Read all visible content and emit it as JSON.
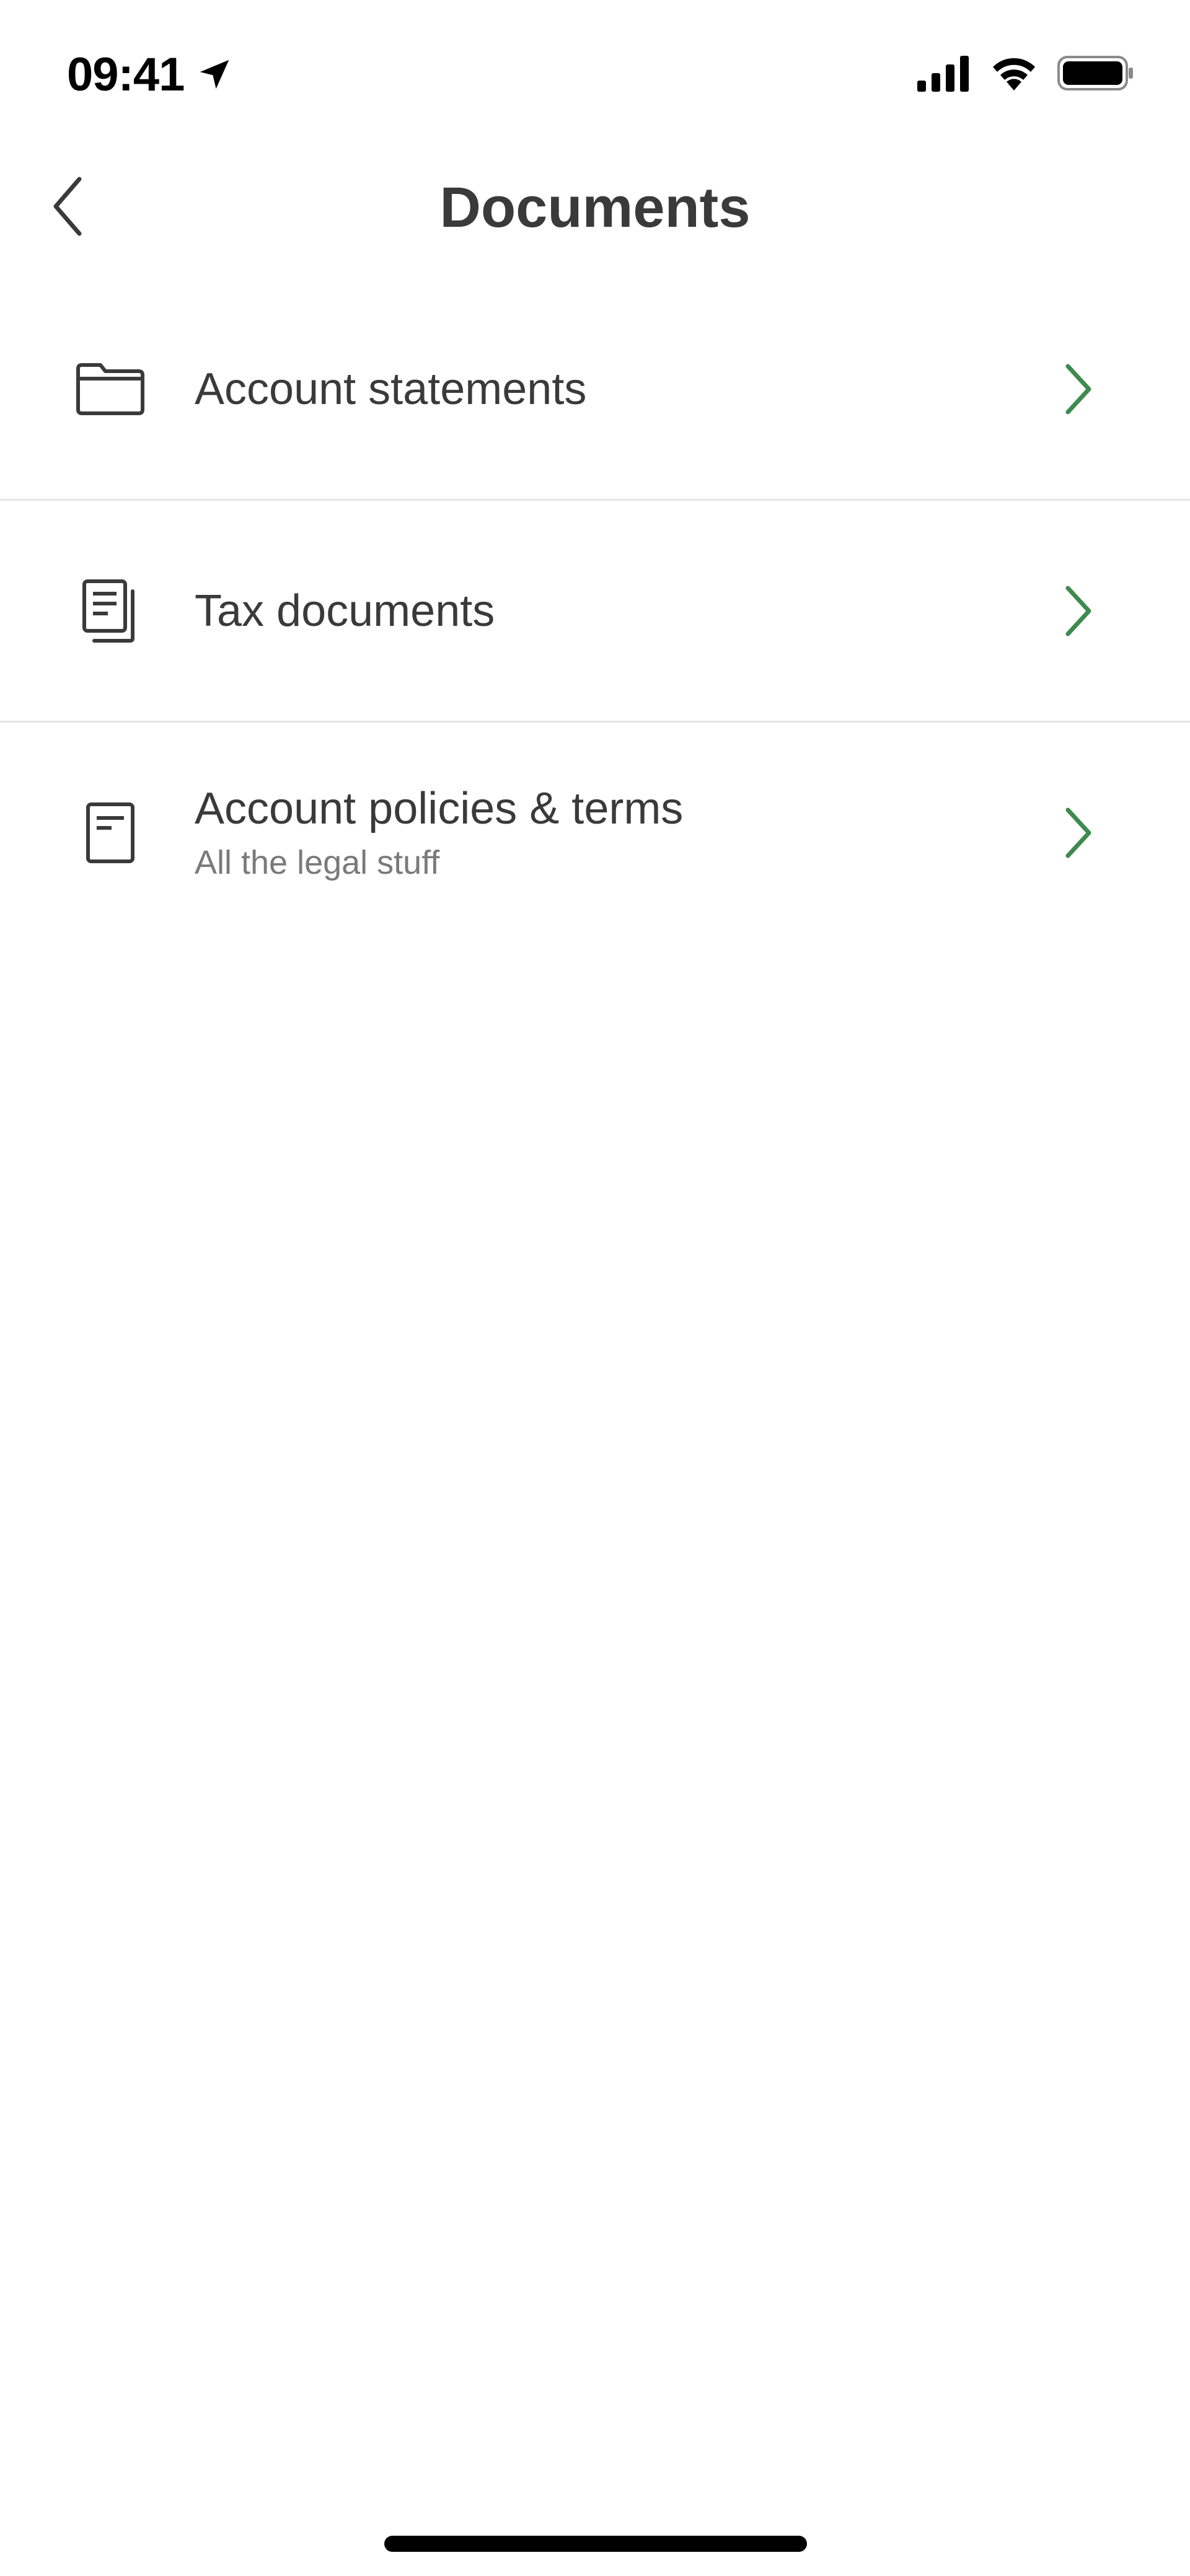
{
  "status_bar": {
    "time": "09:41",
    "icons": [
      "location-arrow-icon",
      "cellular-signal-icon",
      "wifi-icon",
      "battery-icon"
    ]
  },
  "nav": {
    "back_icon": "chevron-left-icon",
    "title": "Documents"
  },
  "items": [
    {
      "icon": "folder-icon",
      "label": "Account statements",
      "sublabel": null,
      "chevron": "chevron-right-icon"
    },
    {
      "icon": "documents-stack-icon",
      "label": "Tax documents",
      "sublabel": null,
      "chevron": "chevron-right-icon"
    },
    {
      "icon": "document-icon",
      "label": "Account policies & terms",
      "sublabel": "All the legal stuff",
      "chevron": "chevron-right-icon"
    }
  ],
  "colors": {
    "accent_chevron": "#3f8a4f",
    "text_primary": "#3a3a3a",
    "text_secondary": "#7a7a7a",
    "divider": "#e4e4e4",
    "background": "#ffffff"
  }
}
